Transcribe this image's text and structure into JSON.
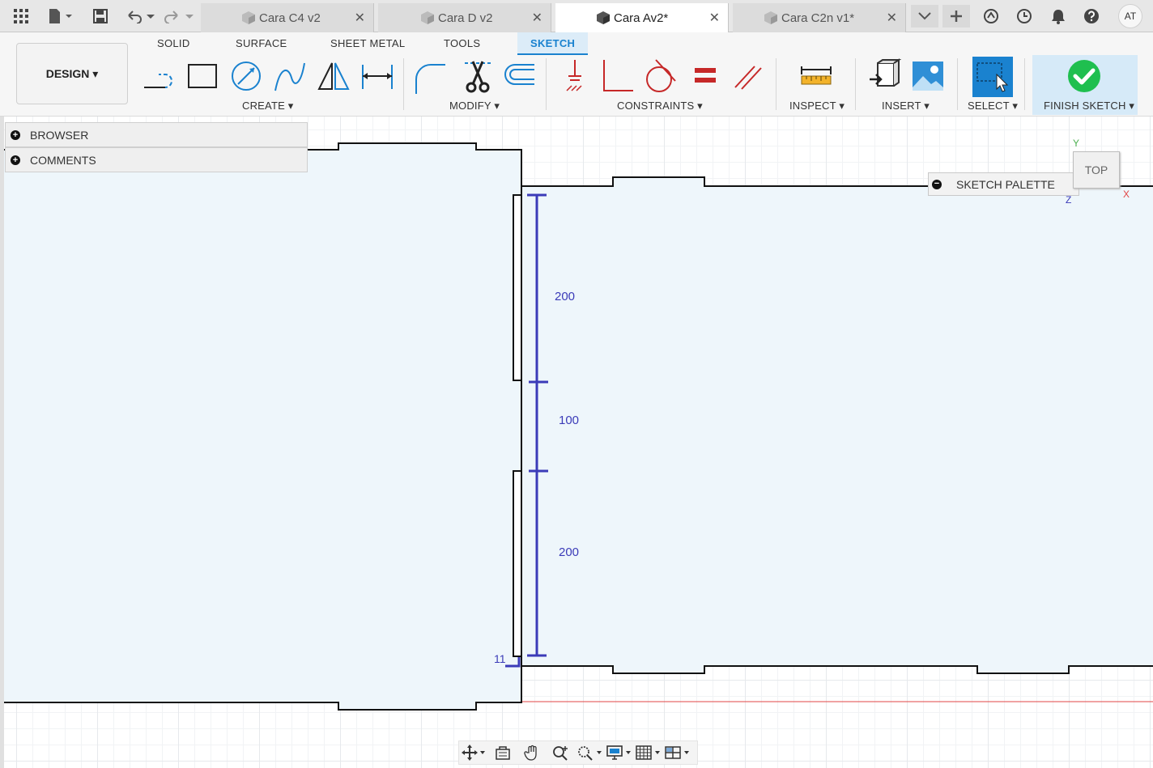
{
  "tabs": [
    {
      "label": "Cara C4 v2",
      "active": false
    },
    {
      "label": "Cara D v2",
      "active": false
    },
    {
      "label": "Cara Av2*",
      "active": true
    },
    {
      "label": "Cara C2n v1*",
      "active": false
    }
  ],
  "tab_close": "✕",
  "user_initials": "AT",
  "workspace": "DESIGN ▾",
  "ribbon_tabs": [
    "SOLID",
    "SURFACE",
    "SHEET METAL",
    "TOOLS",
    "SKETCH"
  ],
  "active_ribbon_tab": "SKETCH",
  "groups": {
    "create": "CREATE ▾",
    "modify": "MODIFY ▾",
    "constraints": "CONSTRAINTS ▾",
    "inspect": "INSPECT ▾",
    "insert": "INSERT ▾",
    "select": "SELECT ▾",
    "finish": "FINISH SKETCH ▾"
  },
  "browser": {
    "browser_label": "BROWSER",
    "comments_label": "COMMENTS"
  },
  "sketch_palette": "SKETCH PALETTE",
  "viewcube": {
    "face": "TOP",
    "axis_y": "Y",
    "axis_x": "X",
    "axis_z": "Z"
  },
  "dimensions": {
    "d1": "200",
    "d2": "100",
    "d3": "200",
    "d4": "11"
  },
  "colors": {
    "accent": "#1a82cf",
    "dimension": "#3b3bb8",
    "finish_check": "#1fbf4f",
    "sketch_fill": "#eef6fb"
  }
}
